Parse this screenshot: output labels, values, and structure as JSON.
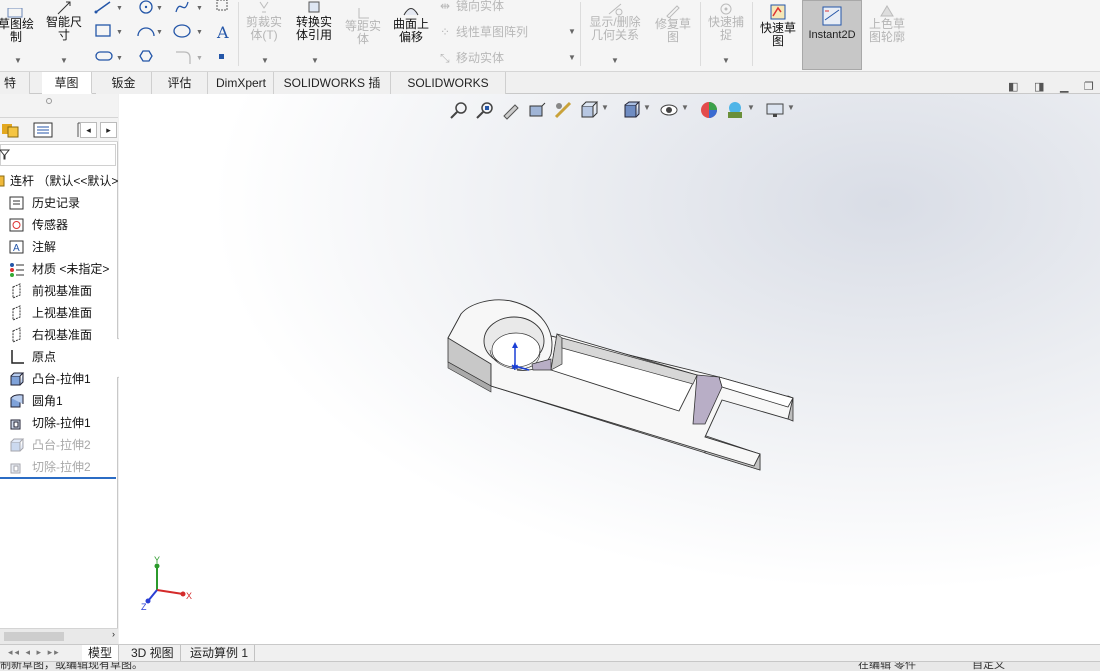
{
  "ribbon": {
    "sketch_label": "草图绘\n制",
    "smart_dim_label": "智能尺\n寸",
    "trim_label": "剪裁实\n体(T)",
    "convert_label": "转换实\n体引用",
    "offset_label": "等距实\n体",
    "surface_offset_label": "曲面上\n偏移",
    "mirror_label": "镜向实体",
    "linear_pattern_label": "线性草图阵列",
    "move_label": "移动实体",
    "display_delete_label": "显示/删除\n几何关系",
    "repair_label": "修复草\n图",
    "quick_snap_label": "快速捕\n捉",
    "rapid_sketch_label": "快速草\n图",
    "instant2d_label": "Instant2D",
    "shaded_sketch_label": "上色草\n图轮廓"
  },
  "tabs": [
    "特征",
    "草图",
    "钣金",
    "评估",
    "DimXpert",
    "SOLIDWORKS 插件",
    "SOLIDWORKS MBD"
  ],
  "active_tab": "草图",
  "tree": {
    "root": "连杆 （默认<<默认>",
    "items": [
      {
        "label": "历史记录",
        "icon": "history-icon",
        "dim": false
      },
      {
        "label": "传感器",
        "icon": "sensor-icon",
        "dim": false
      },
      {
        "label": "注解",
        "icon": "annotation-icon",
        "dim": false
      },
      {
        "label": "材质 <未指定>",
        "icon": "material-icon",
        "dim": false
      },
      {
        "label": "前视基准面",
        "icon": "plane-icon",
        "dim": false
      },
      {
        "label": "上视基准面",
        "icon": "plane-icon",
        "dim": false
      },
      {
        "label": "右视基准面",
        "icon": "plane-icon",
        "dim": false
      },
      {
        "label": "原点",
        "icon": "origin-icon",
        "dim": false
      },
      {
        "label": "凸台-拉伸1",
        "icon": "extrude-icon",
        "dim": false
      },
      {
        "label": "圆角1",
        "icon": "fillet-icon",
        "dim": false
      },
      {
        "label": "切除-拉伸1",
        "icon": "cut-icon",
        "dim": false
      },
      {
        "label": "凸台-拉伸2",
        "icon": "extrude-icon",
        "dim": true
      },
      {
        "label": "切除-拉伸2",
        "icon": "cut-icon",
        "dim": true
      }
    ]
  },
  "triad": {
    "x": "X",
    "y": "Y",
    "z": "Z"
  },
  "bottom_tabs": [
    "模型",
    "3D 视图",
    "运动算例 1"
  ],
  "active_bottom_tab": "模型",
  "status": {
    "left": "制新草图，或编辑现有草图。",
    "middle": "在编辑 零件",
    "right": "自定义"
  },
  "colors": {
    "accent": "#2b6cc4",
    "part_face": "#c9c9c9",
    "part_top": "#ffffff",
    "selected_tab": "#c7c7c7"
  }
}
